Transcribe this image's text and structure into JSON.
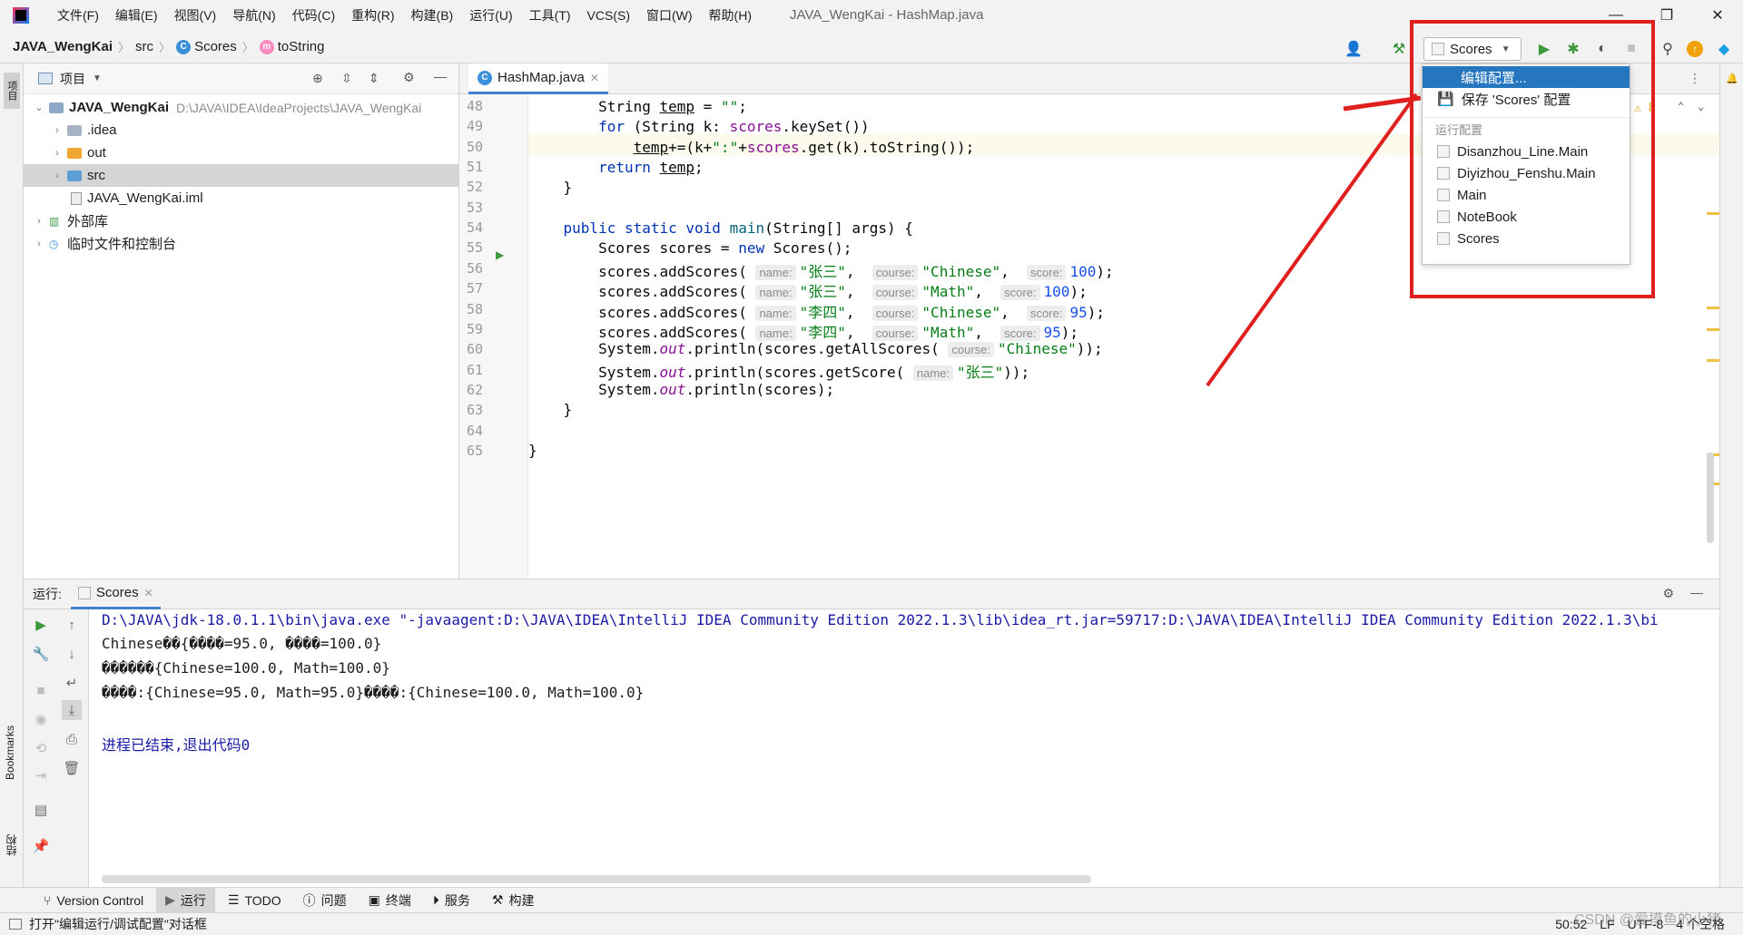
{
  "titlebar": {
    "menus": [
      "文件(F)",
      "编辑(E)",
      "视图(V)",
      "导航(N)",
      "代码(C)",
      "重构(R)",
      "构建(B)",
      "运行(U)",
      "工具(T)",
      "VCS(S)",
      "窗口(W)",
      "帮助(H)"
    ],
    "window_title": "JAVA_WengKai - HashMap.java"
  },
  "navbar": {
    "project": "JAVA_WengKai",
    "folder": "src",
    "class": "Scores",
    "method": "toString",
    "run_config": "Scores"
  },
  "project_panel": {
    "title": "项目",
    "root_name": "JAVA_WengKai",
    "root_path": "D:\\JAVA\\IDEA\\IdeaProjects\\JAVA_WengKai",
    "items": [
      ".idea",
      "out",
      "src",
      "JAVA_WengKai.iml",
      "外部库",
      "临时文件和控制台"
    ]
  },
  "editor": {
    "tab": "HashMap.java",
    "line_numbers": [
      "48",
      "49",
      "50",
      "51",
      "52",
      "53",
      "54",
      "55",
      "56",
      "57",
      "58",
      "59",
      "60",
      "61",
      "62",
      "63",
      "64",
      "65"
    ],
    "warning_count": "8"
  },
  "dropdown": {
    "edit_config": "编辑配置...",
    "save_config": "保存 'Scores' 配置",
    "section_header": "运行配置",
    "configs": [
      "Disanzhou_Line.Main",
      "Diyizhou_Fenshu.Main",
      "Main",
      "NoteBook",
      "Scores"
    ]
  },
  "run_panel": {
    "label": "运行:",
    "tab": "Scores",
    "console": [
      "D:\\JAVA\\jdk-18.0.1.1\\bin\\java.exe \"-javaagent:D:\\JAVA\\IDEA\\IntelliJ IDEA Community Edition 2022.1.3\\lib\\idea_rt.jar=59717:D:\\JAVA\\IDEA\\IntelliJ IDEA Community Edition 2022.1.3\\bi",
      "Chinese��{����=95.0, ����=100.0}",
      "������{Chinese=100.0, Math=100.0}",
      "����:{Chinese=95.0, Math=95.0}����:{Chinese=100.0, Math=100.0}",
      "进程已结束,退出代码0"
    ]
  },
  "bottom_tools": [
    "Version Control",
    "运行",
    "TODO",
    "问题",
    "终端",
    "服务",
    "构建"
  ],
  "statusbar": {
    "message": "打开\"编辑运行/调试配置\"对话框",
    "position": "50:52",
    "line_sep": "LF",
    "encoding": "UTF-8",
    "indent": "4 个空格"
  },
  "side": {
    "project_label": "项目",
    "bookmarks": "Bookmarks",
    "structure": "结构"
  },
  "watermark": "CSDN @爱摸鱼的小猪",
  "colors": {
    "accent": "#2675bf",
    "highlight_red": "#e0201f"
  }
}
